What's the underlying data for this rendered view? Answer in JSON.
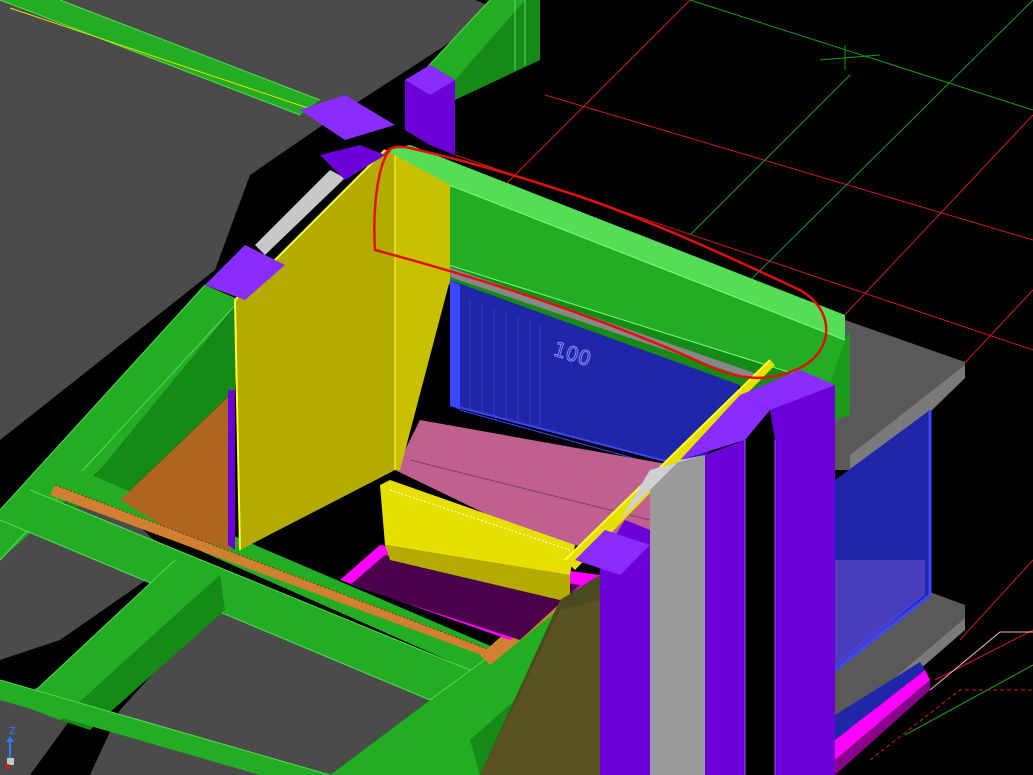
{
  "viewport": {
    "background": "#000000",
    "visual_style": "shaded"
  },
  "colors": {
    "slab": "#4b4b4b",
    "slab_edge": "#6e6e6e",
    "beam": "#22ad22",
    "beam_light": "#55dd55",
    "beam_dark": "#168a16",
    "column": "#6c00d8",
    "column_light": "#8a2cff",
    "wall": "#b3ab00",
    "wall_light": "#e6df00",
    "wall_edge": "#ffff33",
    "glass": "#1f26a8",
    "glass_edge": "#3b46ff",
    "floor_pink": "#c06090",
    "void_dark": "#4a004a",
    "magenta": "#ff00ff",
    "orange": "#b0651e",
    "grey_panel": "#c8c8c8",
    "grid_red": "#d41818",
    "grid_green": "#10a010",
    "markup": "#e01010"
  },
  "dimension_text": "100",
  "ucs": {
    "axis_label": "Z",
    "axis_icon": "ucs-icon"
  },
  "markup": {
    "shape": "freehand-loop",
    "target": "upper-green-beam"
  }
}
